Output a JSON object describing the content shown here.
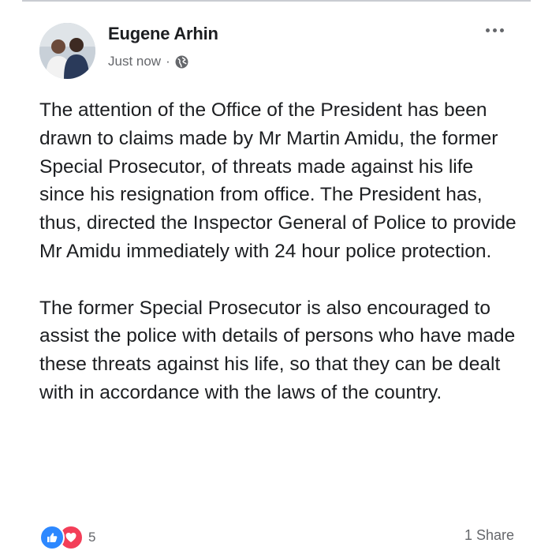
{
  "post": {
    "author": "Eugene Arhin",
    "timestamp": "Just now",
    "separator": "·",
    "privacy_icon": "globe-icon",
    "more_icon": "more-dots-icon",
    "paragraphs": [
      "The attention of the Office of the President has been drawn to claims made by Mr Martin Amidu, the former Special Prosecutor, of threats made against his life since his resignation from office. The President has, thus, directed the Inspector General of Police to provide Mr Amidu immediately with 24 hour police protection.",
      "The former Special Prosecutor is also encouraged to assist the police with details of persons who have made these threats against his life, so that they can be dealt with in accordance with the laws of the country."
    ],
    "reactions": {
      "icons": [
        "like-icon",
        "love-icon"
      ],
      "count": "5"
    },
    "shares": "1 Share"
  },
  "colors": {
    "like": "#2d88ff",
    "love": "#f33e58",
    "text": "#1c1e21",
    "secondary": "#65676b"
  }
}
